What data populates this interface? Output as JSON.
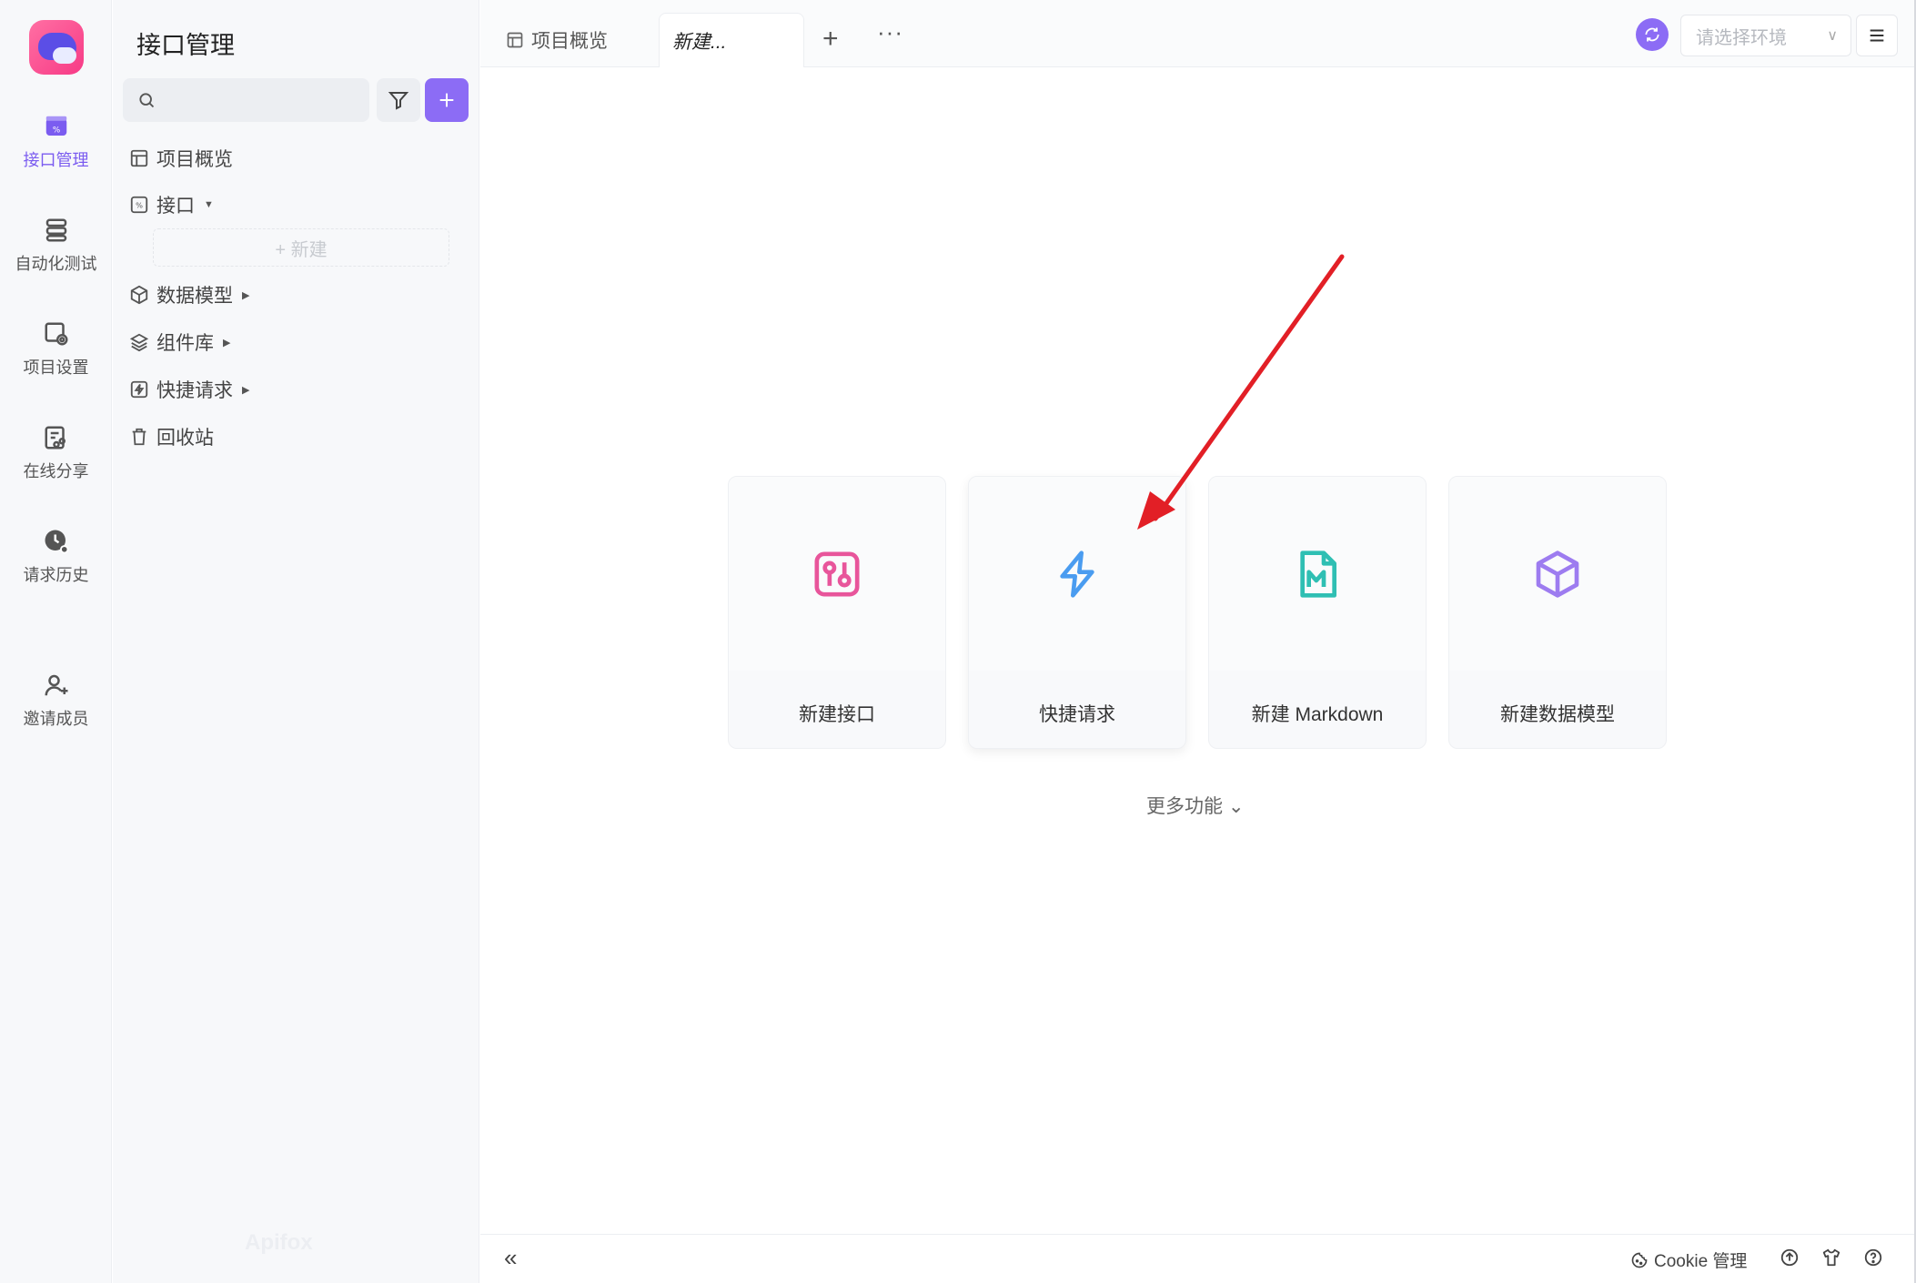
{
  "rail": {
    "items": [
      {
        "label": "接口管理",
        "icon": "api-icon",
        "active": true
      },
      {
        "label": "自动化测试",
        "icon": "database-icon",
        "active": false
      },
      {
        "label": "项目设置",
        "icon": "settings-icon",
        "active": false
      },
      {
        "label": "在线分享",
        "icon": "share-icon",
        "active": false
      },
      {
        "label": "请求历史",
        "icon": "history-icon",
        "active": false
      },
      {
        "label": "邀请成员",
        "icon": "add-user-icon",
        "active": false
      }
    ]
  },
  "sidebar": {
    "title": "接口管理",
    "search_placeholder": "",
    "tree": [
      {
        "label": "项目概览",
        "icon": "layout-icon"
      },
      {
        "label": "接口",
        "icon": "api-icon",
        "caret": "▼"
      },
      {
        "label": "数据模型",
        "icon": "cube-icon",
        "caret": "▶"
      },
      {
        "label": "组件库",
        "icon": "layers-icon",
        "caret": "▶"
      },
      {
        "label": "快捷请求",
        "icon": "lightning-icon",
        "caret": "▶"
      },
      {
        "label": "回收站",
        "icon": "trash-icon"
      }
    ],
    "new_label": "+ 新建",
    "watermark": "Apifox"
  },
  "tabs": {
    "items": [
      {
        "label": "项目概览",
        "icon": "layout-icon"
      },
      {
        "label": "新建...",
        "active": true
      }
    ],
    "add_label": "+",
    "more_label": "···"
  },
  "header": {
    "env_placeholder": "请选择环境",
    "env_chevron": "∨"
  },
  "cards": [
    {
      "label": "新建接口",
      "icon": "api-icon",
      "color": "#e8559b"
    },
    {
      "label": "快捷请求",
      "icon": "lightning-icon",
      "color": "#4a9cf0"
    },
    {
      "label": "新建 Markdown",
      "icon": "markdown-icon",
      "color": "#2fbfb3"
    },
    {
      "label": "新建数据模型",
      "icon": "cube-icon",
      "color": "#9d7cf0"
    }
  ],
  "more_features": "更多功能 ⌄",
  "bottom": {
    "collapse": "«",
    "cookie_label": "Cookie 管理"
  },
  "colors": {
    "accent": "#8c6cf5",
    "annotation_arrow": "#e21f26"
  }
}
